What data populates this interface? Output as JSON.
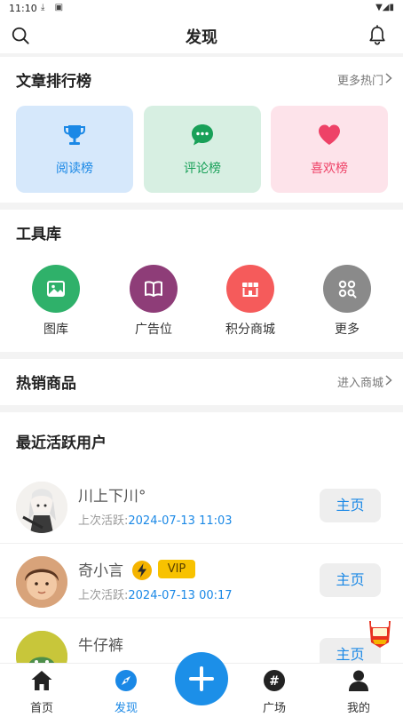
{
  "status_bar": {
    "time": "11:10"
  },
  "header": {
    "title": "发现"
  },
  "rankings": {
    "title": "文章排行榜",
    "more": "更多热门",
    "items": [
      {
        "label": "阅读榜",
        "icon": "trophy-icon",
        "bg": "#d6e8fb",
        "color": "#1a88e6"
      },
      {
        "label": "评论榜",
        "icon": "chat-icon",
        "bg": "#d7efe2",
        "color": "#18a058"
      },
      {
        "label": "喜欢榜",
        "icon": "heart-icon",
        "bg": "#fde3ea",
        "color": "#ee4267"
      }
    ]
  },
  "tools": {
    "title": "工具库",
    "items": [
      {
        "label": "图库",
        "icon": "image-icon",
        "color": "#2fb16a"
      },
      {
        "label": "广告位",
        "icon": "book-icon",
        "color": "#8e3d78"
      },
      {
        "label": "积分商城",
        "icon": "store-icon",
        "color": "#f55b5b"
      },
      {
        "label": "更多",
        "icon": "grid-search-icon",
        "color": "#8a8a8a"
      }
    ]
  },
  "hot_goods": {
    "title": "热销商品",
    "more": "进入商城"
  },
  "active_users": {
    "title": "最近活跃用户",
    "last_active_label": "上次活跃:",
    "home_label": "主页",
    "users": [
      {
        "name": "川上下川°",
        "time": "2024-07-13 11:03"
      },
      {
        "name": "奇小言",
        "time": "2024-07-13 00:17",
        "vip": "VIP"
      },
      {
        "name": "牛仔裤",
        "time": ""
      }
    ]
  },
  "bottom_nav": {
    "items": [
      {
        "label": "首页"
      },
      {
        "label": "发现"
      },
      {
        "label": "广场"
      },
      {
        "label": "我的"
      }
    ]
  },
  "colors": {
    "accent": "#1a88e6",
    "fab": "#1c8fe8"
  }
}
